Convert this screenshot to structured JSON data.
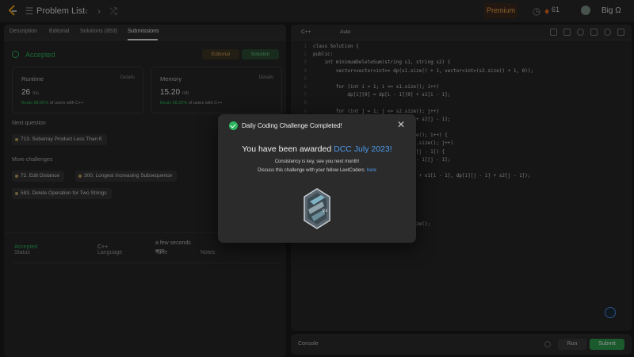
{
  "topnav": {
    "problem_list": "Problem List",
    "premium": "Premium",
    "streak": "61",
    "username": "Big Ω"
  },
  "tabs": [
    {
      "label": "Description"
    },
    {
      "label": "Editorial"
    },
    {
      "label": "Solutions (853)"
    },
    {
      "label": "Submissions"
    }
  ],
  "submission": {
    "status": "Accepted",
    "editorial_label": "Editorial",
    "solution_label": "Solution",
    "runtime": {
      "label": "Runtime",
      "details": "Details",
      "value": "26",
      "unit": "ms",
      "beats_pct": "Beats 88.95%",
      "beats_text": "of users with C++"
    },
    "memory": {
      "label": "Memory",
      "details": "Details",
      "value": "15.20",
      "unit": "mb",
      "beats_pct": "Beats 68.25%",
      "beats_text": "of users with C++"
    }
  },
  "next_question": {
    "label": "Next question",
    "item": "713. Subarray Product Less Than K"
  },
  "more_challenges": {
    "label": "More challenges",
    "items": [
      "72. Edit Distance",
      "300. Longest Increasing Subsequence",
      "583. Delete Operation for Two Strings"
    ]
  },
  "table": {
    "headers": {
      "status": "Status",
      "language": "Language",
      "time": "Time",
      "notes": "Notes"
    },
    "rows": [
      {
        "status": "Accepted",
        "language": "C++",
        "time_line1": "a few seconds",
        "time_line2": "ago"
      }
    ]
  },
  "editor": {
    "language": "C++",
    "mode": "Auto",
    "lines": [
      {
        "n": "1",
        "text": "class Solution {"
      },
      {
        "n": "2",
        "text": "public:"
      },
      {
        "n": "3",
        "text": "    int minimumDeleteSum(string s1, string s2) {"
      },
      {
        "n": "4",
        "text": "        vector<vector<int>> dp(s1.size() + 1, vector<int>(s2.size() + 1, 0));"
      },
      {
        "n": "5",
        "text": ""
      },
      {
        "n": "6",
        "text": "        for (int i = 1; i <= s1.size(); i++)"
      },
      {
        "n": "7",
        "text": "            dp[i][0] = dp[i - 1][0] + s1[i - 1];"
      },
      {
        "n": "8",
        "text": ""
      },
      {
        "n": "9",
        "text": "        for (int j = 1; j <= s2.size(); j++)"
      },
      {
        "n": "10",
        "text": "            dp[0][j] = dp[0][j - 1] + s2[j - 1];"
      },
      {
        "n": "11",
        "text": ""
      },
      {
        "n": "12",
        "text": "                                    e(); i++) {"
      },
      {
        "n": "13",
        "text": "                                    .size(); j++)"
      },
      {
        "n": "14",
        "text": "                                    [j - 1]) {"
      },
      {
        "n": "15",
        "text": "                                    - 1][j - 1];"
      },
      {
        "n": "16",
        "text": ""
      },
      {
        "n": "17",
        "text": "                        dp[i - 1][j] + s1[i - 1], dp[i][j - 1] + s2[j - 1]);"
      },
      {
        "n": "18",
        "text": ""
      },
      {
        "n": "19",
        "text": ""
      },
      {
        "n": "20",
        "text": ""
      },
      {
        "n": "21",
        "text": ""
      },
      {
        "n": "22",
        "text": ""
      },
      {
        "n": "23",
        "text": "                                    ze();"
      }
    ]
  },
  "console": {
    "label": "Console",
    "run": "Run",
    "submit": "Submit"
  },
  "modal": {
    "title": "Daily Coding Challenge Completed!",
    "awarded_prefix": "You have been awarded",
    "award": "DCC July 2023!",
    "consistency": "Consistency is key, see you next month!",
    "discuss": "Discuss this challenge with your fellow LeetCoders",
    "discuss_link": "here",
    "badge_text": "'23"
  }
}
